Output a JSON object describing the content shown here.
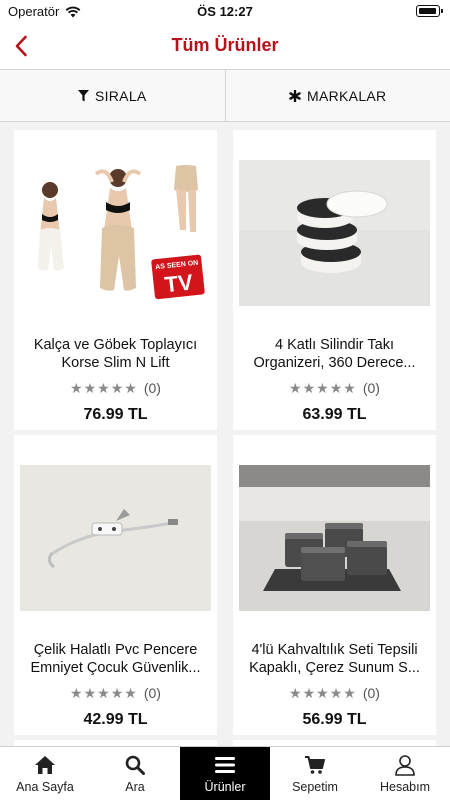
{
  "status": {
    "carrier": "Operatör",
    "time": "ÖS 12:27"
  },
  "header": {
    "title": "Tüm Ürünler"
  },
  "filters": {
    "sort_label": "SIRALA",
    "brands_label": "MARKALAR"
  },
  "products": [
    {
      "name_line1": "Kalça ve Göbek Toplayıcı",
      "name_line2": "Korse Slim N Lift",
      "review_count": "(0)",
      "price": "76.99 TL",
      "badge_line1": "AS SEEN ON",
      "badge_line2": "TV"
    },
    {
      "name_line1": "4 Katlı Silindir Takı",
      "name_line2": "Organizeri, 360 Derece...",
      "review_count": "(0)",
      "price": "63.99 TL"
    },
    {
      "name_line1": "Çelik Halatlı Pvc Pencere",
      "name_line2": "Emniyet Çocuk Güvenlik...",
      "review_count": "(0)",
      "price": "42.99 TL"
    },
    {
      "name_line1": "4'lü Kahvaltılık Seti Tepsili",
      "name_line2": "Kapaklı, Çerez Sunum S...",
      "review_count": "(0)",
      "price": "56.99 TL"
    }
  ],
  "tabs": [
    {
      "label": "Ana Sayfa",
      "icon": "home-icon"
    },
    {
      "label": "Ara",
      "icon": "search-icon"
    },
    {
      "label": "Ürünler",
      "icon": "menu-icon",
      "active": true
    },
    {
      "label": "Sepetim",
      "icon": "cart-icon"
    },
    {
      "label": "Hesabım",
      "icon": "user-icon"
    }
  ],
  "colors": {
    "accent": "#b5121b",
    "active_tab_bg": "#000000",
    "star": "#8a8a8a"
  }
}
